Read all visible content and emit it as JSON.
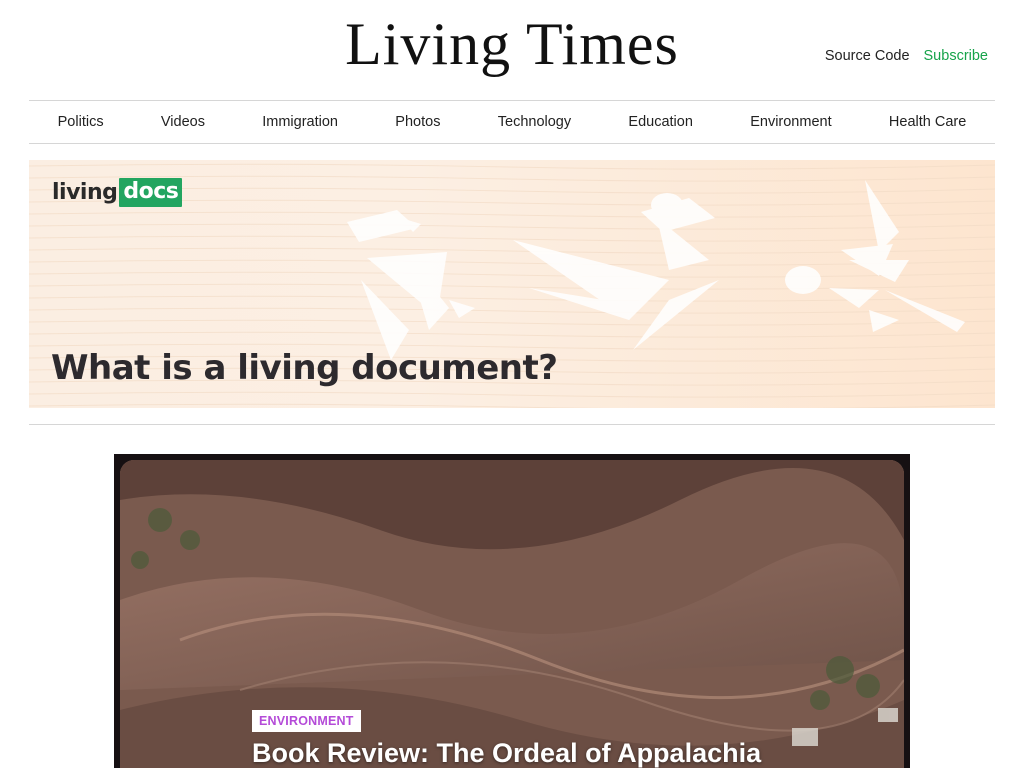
{
  "header": {
    "title": "Living Times",
    "source_code_label": "Source Code",
    "subscribe_label": "Subscribe",
    "subscribe_color": "#16a34a"
  },
  "nav": {
    "items": [
      {
        "label": "Politics"
      },
      {
        "label": "Videos"
      },
      {
        "label": "Immigration"
      },
      {
        "label": "Photos"
      },
      {
        "label": "Technology"
      },
      {
        "label": "Education"
      },
      {
        "label": "Environment"
      },
      {
        "label": "Health Care"
      }
    ]
  },
  "banner": {
    "logo_part1": "living",
    "logo_part2": "docs",
    "logo_color": "#22a560",
    "headline": "What is a living document?"
  },
  "feature": {
    "category": "ENVIRONMENT",
    "category_color": "#b44bd8",
    "title": "Book Review: The Ordeal of Appalachia"
  }
}
